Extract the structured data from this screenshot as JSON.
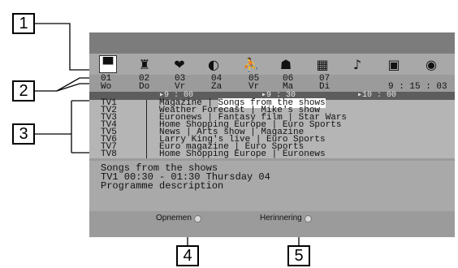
{
  "callouts": [
    "1",
    "2",
    "3",
    "4",
    "5"
  ],
  "icons": [
    {
      "name": "tv-icon",
      "glyph": "▀"
    },
    {
      "name": "robot-icon",
      "glyph": "♜"
    },
    {
      "name": "heart-icon",
      "glyph": "❤"
    },
    {
      "name": "palette-icon",
      "glyph": "◐"
    },
    {
      "name": "sports-icon",
      "glyph": "⛹"
    },
    {
      "name": "people-icon",
      "glyph": "☗"
    },
    {
      "name": "film-icon",
      "glyph": "▦"
    },
    {
      "name": "music-icon",
      "glyph": "♪"
    },
    {
      "name": "teletext-icon",
      "glyph": "▣"
    },
    {
      "name": "radio-icon",
      "glyph": "◉"
    }
  ],
  "dates": {
    "numbers": [
      "01",
      "02",
      "03",
      "04",
      "05",
      "06",
      "07"
    ],
    "days": [
      "Wo",
      "Do",
      "Vr",
      "Za",
      "Vr",
      "Ma",
      "Di"
    ],
    "clock": "9 : 15 : 03"
  },
  "timebar": [
    "9 : 00",
    "9 : 30",
    "10 : 00"
  ],
  "channels": [
    {
      "ch": "TV1",
      "prog": "Magazine  | Songs from the shows",
      "hl": "Songs from the shows"
    },
    {
      "ch": "TV2",
      "prog": "Weather Forecast | Mike's show"
    },
    {
      "ch": "TV3",
      "prog": "Euronews  | Fantasy film  | Star Wars"
    },
    {
      "ch": "TV4",
      "prog": "Home Shopping Europe | Euro Sports"
    },
    {
      "ch": "TV5",
      "prog": "News | Arts show  | Magazine"
    },
    {
      "ch": "TV6",
      "prog": "Larry King's live | Euro Sports"
    },
    {
      "ch": "TV7",
      "prog": "Euro magazine  | Euro Sports"
    },
    {
      "ch": "TV8",
      "prog": "Home Shopping Europe | Euronews"
    }
  ],
  "info": {
    "title": "Songs from the shows",
    "when": "TV1 00:30 - 01:30 Thursday  04",
    "desc": "Programme description"
  },
  "buttons": {
    "record": "Opnemen",
    "reminder": "Herinnering"
  },
  "colors": {
    "screen_bg": "#9b9b9b",
    "topbar": "#7c7c7c",
    "highlight": "#ffffff"
  }
}
